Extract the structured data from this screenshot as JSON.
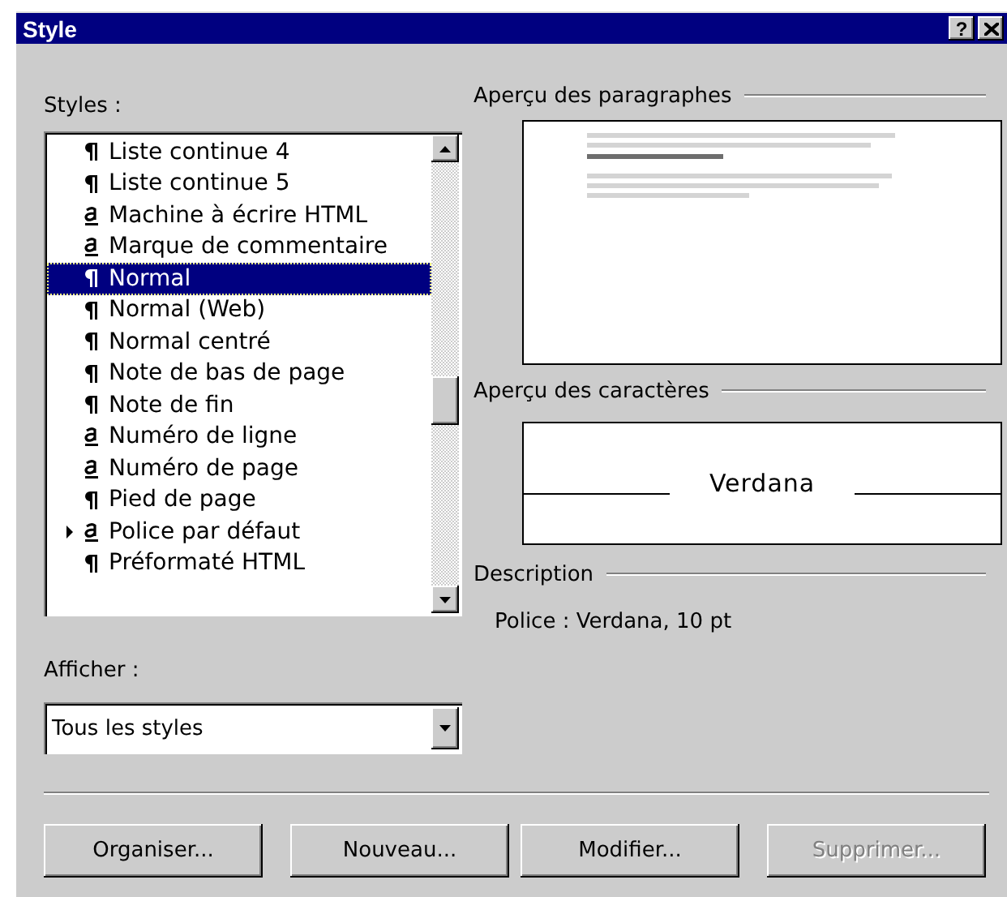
{
  "window": {
    "title": "Style",
    "help_button": "?"
  },
  "styles_list": {
    "label": "Styles :",
    "items": [
      {
        "name": "Liste continue 4",
        "kind": "paragraph",
        "selected": false,
        "default": false
      },
      {
        "name": "Liste continue 5",
        "kind": "paragraph",
        "selected": false,
        "default": false
      },
      {
        "name": "Machine à écrire HTML",
        "kind": "character",
        "selected": false,
        "default": false
      },
      {
        "name": "Marque de commentaire",
        "kind": "character",
        "selected": false,
        "default": false
      },
      {
        "name": "Normal",
        "kind": "paragraph",
        "selected": true,
        "default": false
      },
      {
        "name": "Normal (Web)",
        "kind": "paragraph",
        "selected": false,
        "default": false
      },
      {
        "name": "Normal centré",
        "kind": "paragraph",
        "selected": false,
        "default": false
      },
      {
        "name": "Note de bas de page",
        "kind": "paragraph",
        "selected": false,
        "default": false
      },
      {
        "name": "Note de fin",
        "kind": "paragraph",
        "selected": false,
        "default": false
      },
      {
        "name": "Numéro de ligne",
        "kind": "character",
        "selected": false,
        "default": false
      },
      {
        "name": "Numéro de page",
        "kind": "character",
        "selected": false,
        "default": false
      },
      {
        "name": "Pied de page",
        "kind": "paragraph",
        "selected": false,
        "default": false
      },
      {
        "name": "Police par défaut",
        "kind": "character",
        "selected": false,
        "default": true
      },
      {
        "name": "Préformaté HTML",
        "kind": "paragraph",
        "selected": false,
        "default": false
      }
    ]
  },
  "show": {
    "label": "Afficher :",
    "value": "Tous les styles"
  },
  "paragraph_preview": {
    "label": "Aperçu des paragraphes"
  },
  "character_preview": {
    "label": "Aperçu des caractères",
    "sample": "Verdana"
  },
  "description": {
    "label": "Description",
    "text": "Police : Verdana, 10 pt"
  },
  "buttons": [
    {
      "label": "Organiser...",
      "disabled": false
    },
    {
      "label": "Nouveau...",
      "disabled": false
    },
    {
      "label": "Modifier...",
      "disabled": false
    },
    {
      "label": "Supprimer...",
      "disabled": true
    }
  ]
}
